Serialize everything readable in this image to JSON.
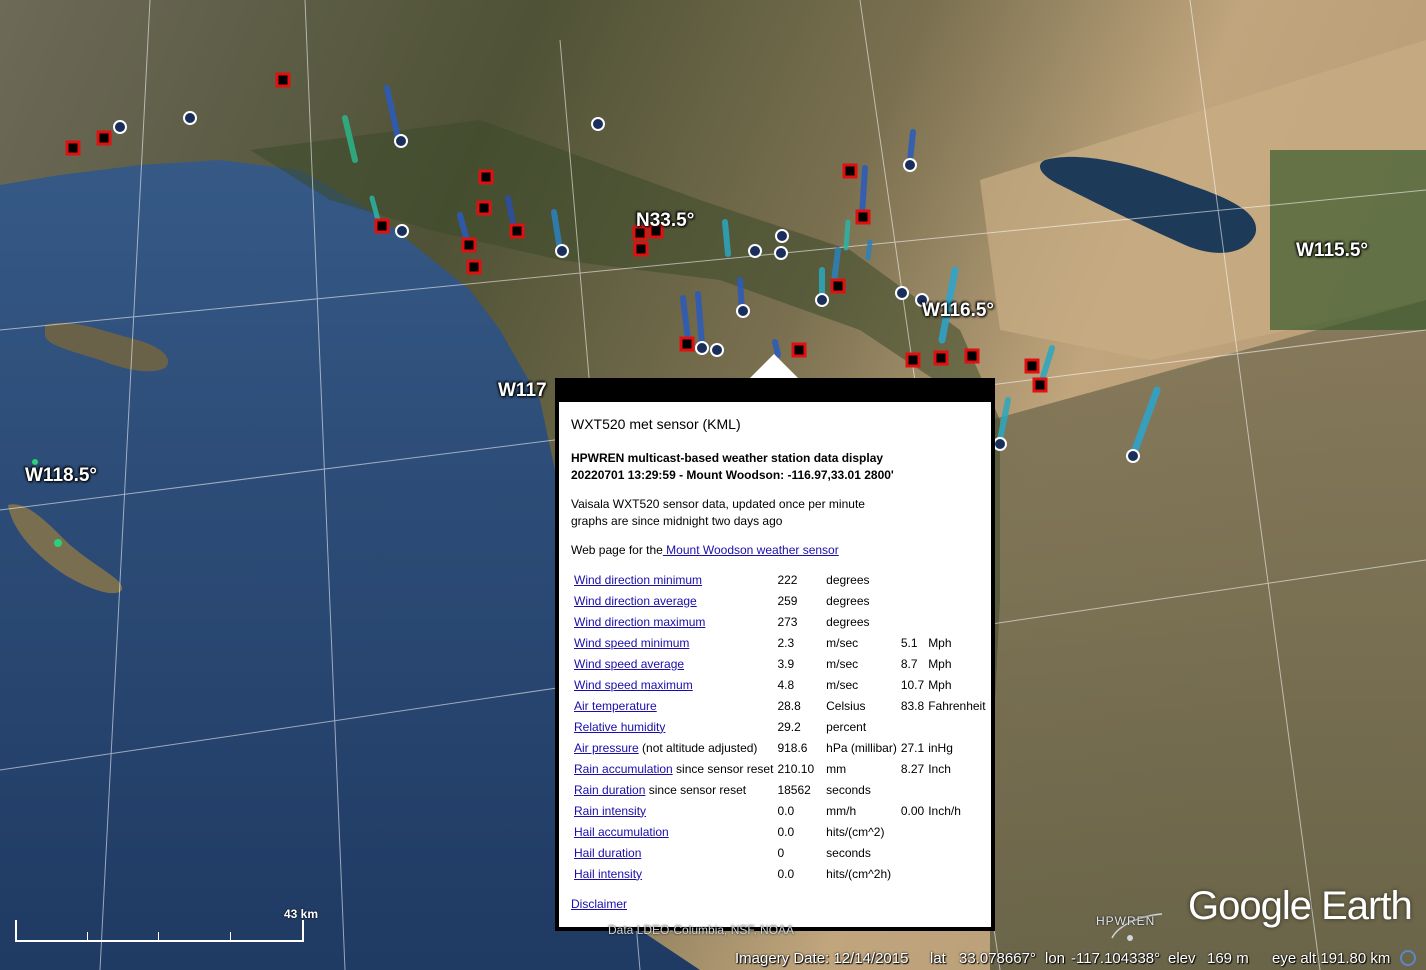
{
  "colors": {
    "ocean": "#2a4a78",
    "land_green": "#3b4a2a",
    "desert": "#b8a07a",
    "salton_sea": "#1d3b58",
    "station_red": "#e01010",
    "link_blue": "#1a0dab"
  },
  "map": {
    "grid_labels": [
      "N33.5°",
      "W115.5°",
      "W116.5°",
      "W117",
      "W118.5°"
    ],
    "scale_label": "43 km",
    "attribution": "Data LDEO-Columbia, NSF, NOAA",
    "logo": "Google Earth",
    "overlay_logo": "HPWREN",
    "markers": {
      "red_square_icon": "red-square-marker-icon",
      "globe_icon": "globe-station-marker-icon",
      "wind_column_icon": "wind-column-icon"
    }
  },
  "status": {
    "imagery_date": "Imagery Date: 12/14/2015",
    "lat_label": "lat",
    "lat_value": "33.078667°",
    "lon_label": "lon",
    "lon_value": "-117.104338°",
    "elev_label": "elev",
    "elev_value": "169 m",
    "eye_alt": "eye alt 191.80 km"
  },
  "popup": {
    "title": "WXT520 met sensor (KML)",
    "header_line1": "HPWREN multicast-based weather station data display",
    "header_line2": "20220701 13:29:59 - Mount Woodson: -116.97,33.01 2800'",
    "desc_line1": "Vaisala WXT520 sensor data, updated once per minute",
    "desc_line2": "graphs are since midnight two days ago",
    "webpage_prefix": "Web page for the",
    "webpage_link": " Mount Woodson weather sensor",
    "disclaimer": "Disclaimer",
    "rows": [
      {
        "label": "Wind direction minimum",
        "suffix": "",
        "value": "222",
        "unit": "degrees",
        "value2": "",
        "unit2": ""
      },
      {
        "label": "Wind direction average",
        "suffix": "",
        "value": "259",
        "unit": "degrees",
        "value2": "",
        "unit2": ""
      },
      {
        "label": "Wind direction maximum",
        "suffix": "",
        "value": "273",
        "unit": "degrees",
        "value2": "",
        "unit2": ""
      },
      {
        "label": "Wind speed minimum",
        "suffix": "",
        "value": "2.3",
        "unit": "m/sec",
        "value2": "5.1",
        "unit2": "Mph"
      },
      {
        "label": "Wind speed average",
        "suffix": "",
        "value": "3.9",
        "unit": "m/sec",
        "value2": "8.7",
        "unit2": "Mph"
      },
      {
        "label": "Wind speed maximum",
        "suffix": "",
        "value": "4.8",
        "unit": "m/sec",
        "value2": "10.7",
        "unit2": "Mph"
      },
      {
        "label": "Air temperature",
        "suffix": "",
        "value": "28.8",
        "unit": "Celsius",
        "value2": "83.8",
        "unit2": "Fahrenheit"
      },
      {
        "label": "Relative humidity",
        "suffix": "",
        "value": "29.2",
        "unit": "percent",
        "value2": "",
        "unit2": ""
      },
      {
        "label": "Air pressure",
        "suffix": " (not altitude adjusted)",
        "value": "918.6",
        "unit": "hPa (millibar)",
        "value2": "27.1",
        "unit2": "inHg"
      },
      {
        "label": "Rain accumulation",
        "suffix": " since sensor reset",
        "value": "210.10",
        "unit": "mm",
        "value2": "8.27",
        "unit2": "Inch"
      },
      {
        "label": "Rain duration",
        "suffix": " since sensor reset",
        "value": "18562",
        "unit": "seconds",
        "value2": "",
        "unit2": ""
      },
      {
        "label": "Rain intensity",
        "suffix": "",
        "value": "0.0",
        "unit": "mm/h",
        "value2": "0.00",
        "unit2": "Inch/h"
      },
      {
        "label": "Hail accumulation",
        "suffix": "",
        "value": "0.0",
        "unit": "hits/(cm^2)",
        "value2": "",
        "unit2": ""
      },
      {
        "label": "Hail duration",
        "suffix": "",
        "value": "0",
        "unit": "seconds",
        "value2": "",
        "unit2": ""
      },
      {
        "label": "Hail intensity",
        "suffix": "",
        "value": "0.0",
        "unit": "hits/(cm^2h)",
        "value2": "",
        "unit2": ""
      }
    ]
  }
}
